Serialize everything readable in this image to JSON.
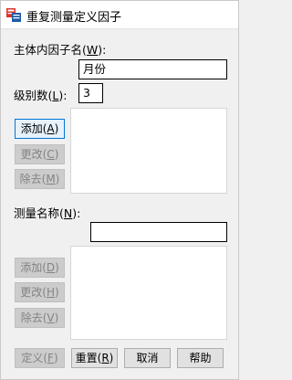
{
  "window": {
    "title": "重复测量定义因子",
    "icon": "spss-app-icon"
  },
  "factor": {
    "name_label": "主体内因子名(",
    "name_key": "W",
    "name_label_end": "):",
    "name_value": "月份",
    "levels_label": "级别数(",
    "levels_key": "L",
    "levels_label_end": "):",
    "levels_value": "3",
    "buttons": {
      "add": {
        "text": "添加(",
        "key": "A",
        "end": ")"
      },
      "change": {
        "text": "更改(",
        "key": "C",
        "end": ")"
      },
      "remove": {
        "text": "除去(",
        "key": "M",
        "end": ")"
      }
    }
  },
  "measure": {
    "name_label": "测量名称(",
    "name_key": "N",
    "name_label_end": "):",
    "name_value": "",
    "buttons": {
      "add": {
        "text": "添加(",
        "key": "D",
        "end": ")"
      },
      "change": {
        "text": "更改(",
        "key": "H",
        "end": ")"
      },
      "remove": {
        "text": "除去(",
        "key": "V",
        "end": ")"
      }
    }
  },
  "footer": {
    "define": {
      "text": "定义(",
      "key": "F",
      "end": ")"
    },
    "reset": {
      "text": "重置(",
      "key": "R",
      "end": ")"
    },
    "cancel": "取消",
    "help": "帮助"
  }
}
